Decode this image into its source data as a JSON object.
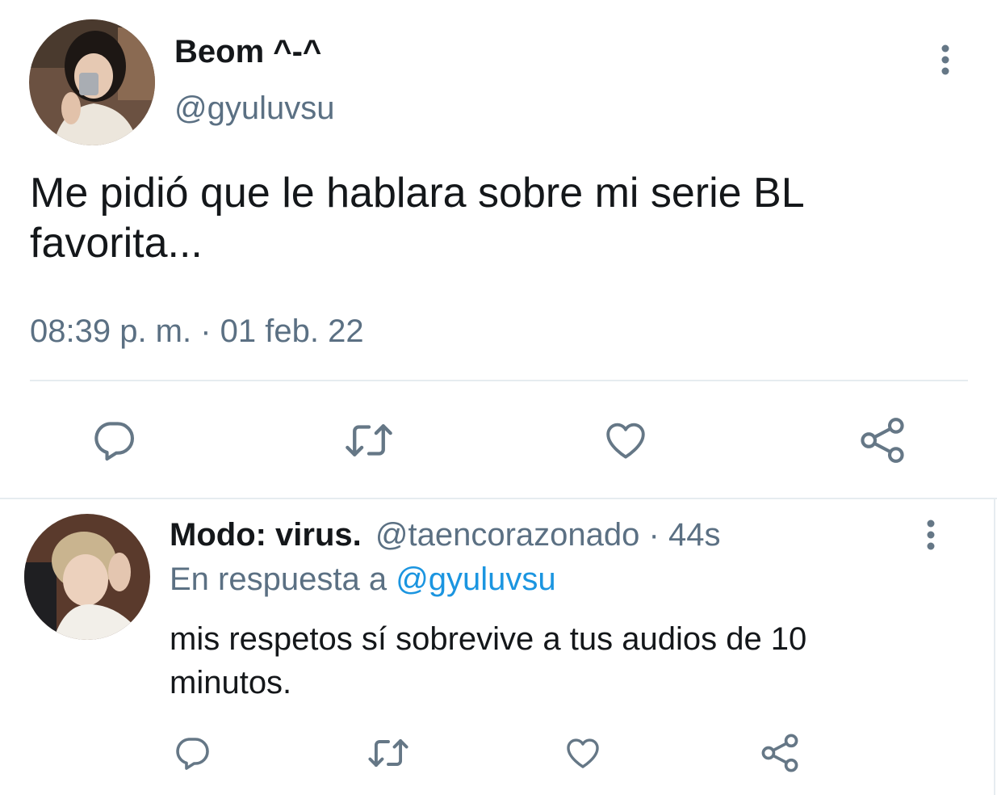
{
  "main_tweet": {
    "author_name": "Beom ^-^",
    "author_handle": "@gyuluvsu",
    "text_line1": "Me pidió que le hablara sobre mi serie BL",
    "text_line2": "favorita...",
    "timestamp": "08:39 p. m. · 01 feb. 22",
    "more_icon": "vertical-ellipsis-icon",
    "actions": {
      "reply_icon": "reply-icon",
      "retweet_icon": "retweet-icon",
      "like_icon": "heart-icon",
      "share_icon": "share-icon"
    }
  },
  "reply_tweet": {
    "author_name": "Modo: virus.",
    "author_handle": "@taencorazonado",
    "separator": "·",
    "time": "44s",
    "in_reply_prefix": "En respuesta a",
    "in_reply_handle": "@gyuluvsu",
    "text_line1": "mis respetos sí sobrevive a tus audios de 10",
    "text_line2": "minutos.",
    "more_icon": "vertical-ellipsis-icon",
    "actions": {
      "reply_icon": "reply-icon",
      "retweet_icon": "retweet-icon",
      "like_icon": "heart-icon",
      "share_icon": "share-icon"
    }
  },
  "colors": {
    "text": "#14171a",
    "secondary": "#5b7083",
    "link": "#1b95e0",
    "icon": "#657786",
    "divider": "#e6ecf0"
  }
}
